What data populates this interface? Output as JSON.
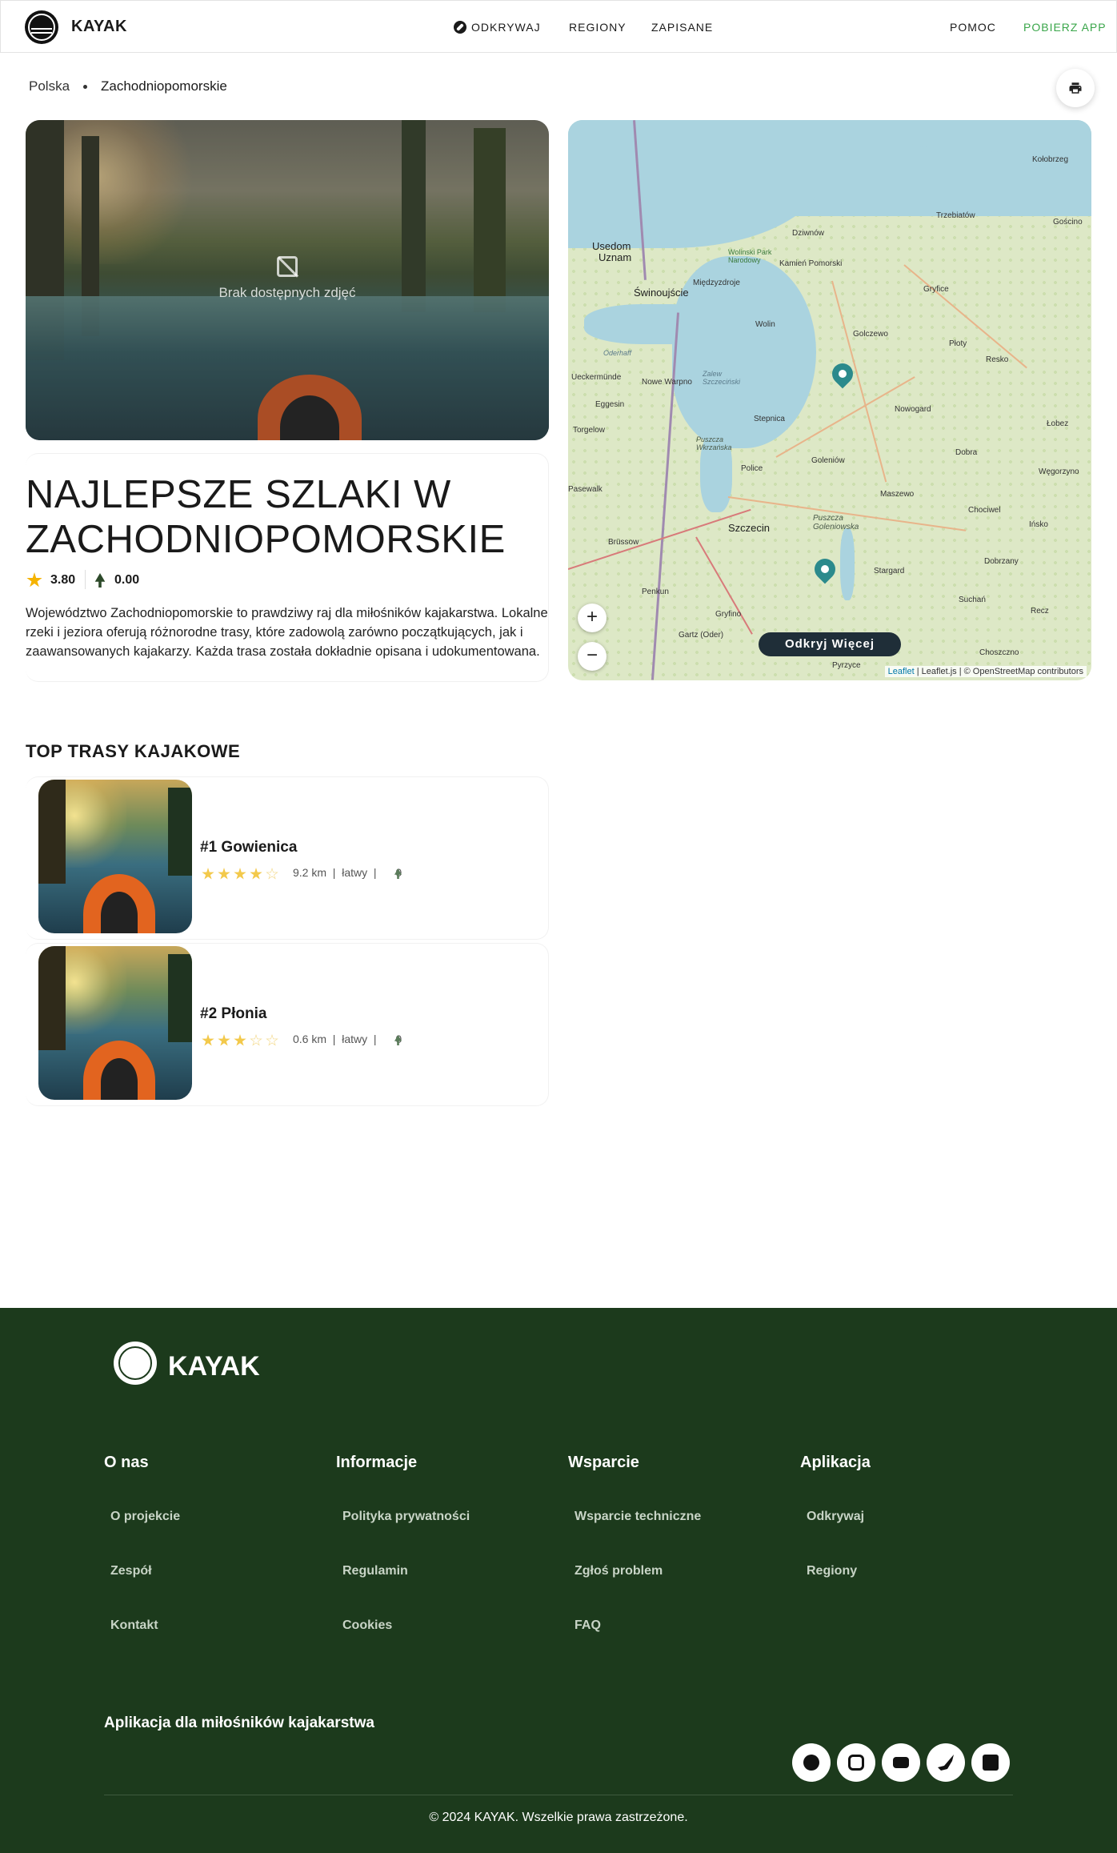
{
  "header": {
    "brand": "KAYAK",
    "nav": {
      "discover": "ODKRYWAJ",
      "regions": "REGIONY",
      "saved": "ZAPISANE"
    },
    "help": "POMOC",
    "get_app": "POBIERZ APP"
  },
  "breadcrumb": {
    "country": "Polska",
    "region": "Zachodniopomorskie"
  },
  "hero": {
    "no_photos": "Brak dostępnych zdjęć"
  },
  "region": {
    "title": "NAJLEPSZE SZLAKI W ZACHODNIOPOMORSKIE",
    "rating": "3.80",
    "nature_score": "0.00",
    "description": "Województwo Zachodniopomorskie to prawdziwy raj dla miłośników kajakarstwa. Lokalne rzeki i jeziora oferują różnorodne trasy, które zadowolą zarówno początkujących, jak i zaawansowanych kajakarzy. Każda trasa została dokładnie opisana i udokumentowana."
  },
  "map": {
    "discover_button": "Odkryj Więcej",
    "attribution_leaflet": "Leaflet",
    "attribution_rest": "| Leaflet.js | © OpenStreetMap contributors",
    "zoom_in": "+",
    "zoom_out": "−",
    "towns": [
      "Kołobrzeg",
      "Trzebiatów",
      "Gościno",
      "Dziwnów",
      "Kamień Pomorski",
      "Usedom",
      "Uznam",
      "Świnoujście",
      "Międzyzdroje",
      "Wolin",
      "Gryfice",
      "Golczewo",
      "Płoty",
      "Resko",
      "Nowe Warpno",
      "Ueckermünde",
      "Eggesin",
      "Torgelow",
      "Stepnica",
      "Nowogard",
      "Łobez",
      "Goleniów",
      "Dobra",
      "Węgorzyno",
      "Pasewalk",
      "Police",
      "Maszewo",
      "Chociwel",
      "Szczecin",
      "Ińsko",
      "Brüssow",
      "Stargard",
      "Dobrzany",
      "Penkun",
      "Gryfino",
      "Suchań",
      "Recz",
      "Gartz (Oder)",
      "Choszczno",
      "Pyrzyce",
      "Wolinski Park Narodowy",
      "Zalew Szczeciński",
      "Puszcza Wkrzańska",
      "Puszcza Goleniowska",
      "Oderhaff"
    ]
  },
  "trails": {
    "section_title": "TOP TRASY KAJAKOWE",
    "items": [
      {
        "name": "#1 Gowienica",
        "stars": 4,
        "distance": "9.2 km",
        "difficulty": "łatwy",
        "nature": "0"
      },
      {
        "name": "#2 Płonia",
        "stars": 3,
        "distance": "0.6 km",
        "difficulty": "łatwy",
        "nature": "0"
      }
    ]
  },
  "footer": {
    "brand": "KAYAK",
    "columns": [
      {
        "title": "O nas",
        "links": [
          "O projekcie",
          "Zespół",
          "Kontakt"
        ]
      },
      {
        "title": "Informacje",
        "links": [
          "Polityka prywatności",
          "Regulamin",
          "Cookies"
        ]
      },
      {
        "title": "Wsparcie",
        "links": [
          "Wsparcie techniczne",
          "Zgłoś problem",
          "FAQ"
        ]
      },
      {
        "title": "Aplikacja",
        "links": [
          "Odkrywaj",
          "Regiony"
        ]
      }
    ],
    "tagline": "Aplikacja dla miłośników kajakarstwa",
    "social": [
      "facebook-icon",
      "instagram-icon",
      "youtube-icon",
      "twitter-icon",
      "linkedin-icon"
    ],
    "copyright": "© 2024 KAYAK. Wszelkie prawa zastrzeżone."
  },
  "colors": {
    "accent_green": "#3aa64a",
    "footer_bg": "#1c3a1c",
    "marker": "#2b8a8c",
    "star": "#f5b301"
  }
}
